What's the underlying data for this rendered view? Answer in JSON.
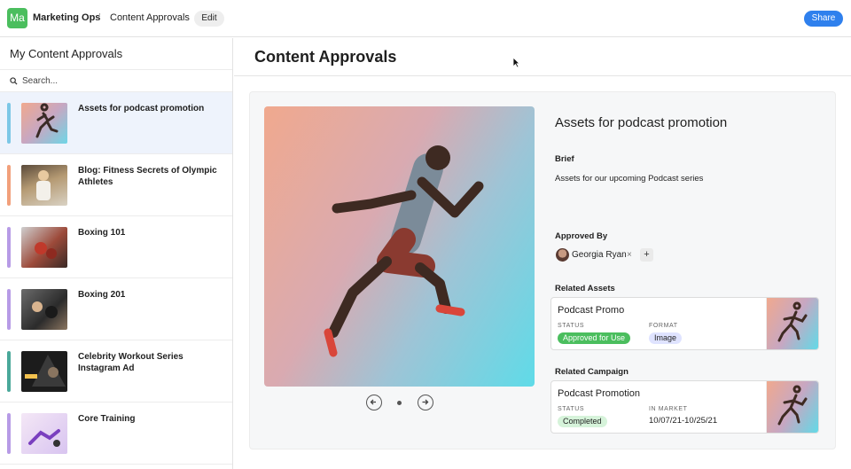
{
  "header": {
    "workspace_initials": "Ma",
    "workspace_name": "Marketing Ops",
    "separator": "/",
    "page": "Content Approvals",
    "edit_label": "Edit",
    "share_label": "Share"
  },
  "sidebar": {
    "title": "My Content Approvals",
    "search_placeholder": "Search...",
    "items": [
      {
        "label": "Assets for podcast promotion",
        "color": "#7cc7e6"
      },
      {
        "label": "Blog: Fitness Secrets of Olympic Athletes",
        "color": "#f2a07b"
      },
      {
        "label": "Boxing 101",
        "color": "#b79be6"
      },
      {
        "label": "Boxing 201",
        "color": "#b79be6"
      },
      {
        "label": "Celebrity Workout Series Instagram Ad",
        "color": "#4aa89a"
      },
      {
        "label": "Core Training",
        "color": "#b79be6"
      }
    ]
  },
  "main": {
    "title": "Content Approvals",
    "detail": {
      "title": "Assets for podcast promotion",
      "brief_label": "Brief",
      "brief_text": "Assets for our upcoming Podcast series",
      "approved_by_label": "Approved By",
      "approver": "Georgia Ryan",
      "remove_glyph": "×",
      "add_glyph": "+",
      "related_assets_label": "Related Assets",
      "related_campaign_label": "Related Campaign",
      "asset": {
        "title": "Podcast Promo",
        "status_key": "STATUS",
        "status_value": "Approved for Use",
        "format_key": "FORMAT",
        "format_value": "Image"
      },
      "campaign": {
        "title": "Podcast Promotion",
        "status_key": "STATUS",
        "status_value": "Completed",
        "market_key": "IN MARKET",
        "market_value": "10/07/21-10/25/21"
      }
    }
  },
  "colors": {
    "accent": "#2f80ed",
    "logo": "#4bbe5e",
    "approved_pill": "#4bbe5e",
    "image_pill": "#dfe3ff",
    "completed_pill": "#d6f3da"
  }
}
